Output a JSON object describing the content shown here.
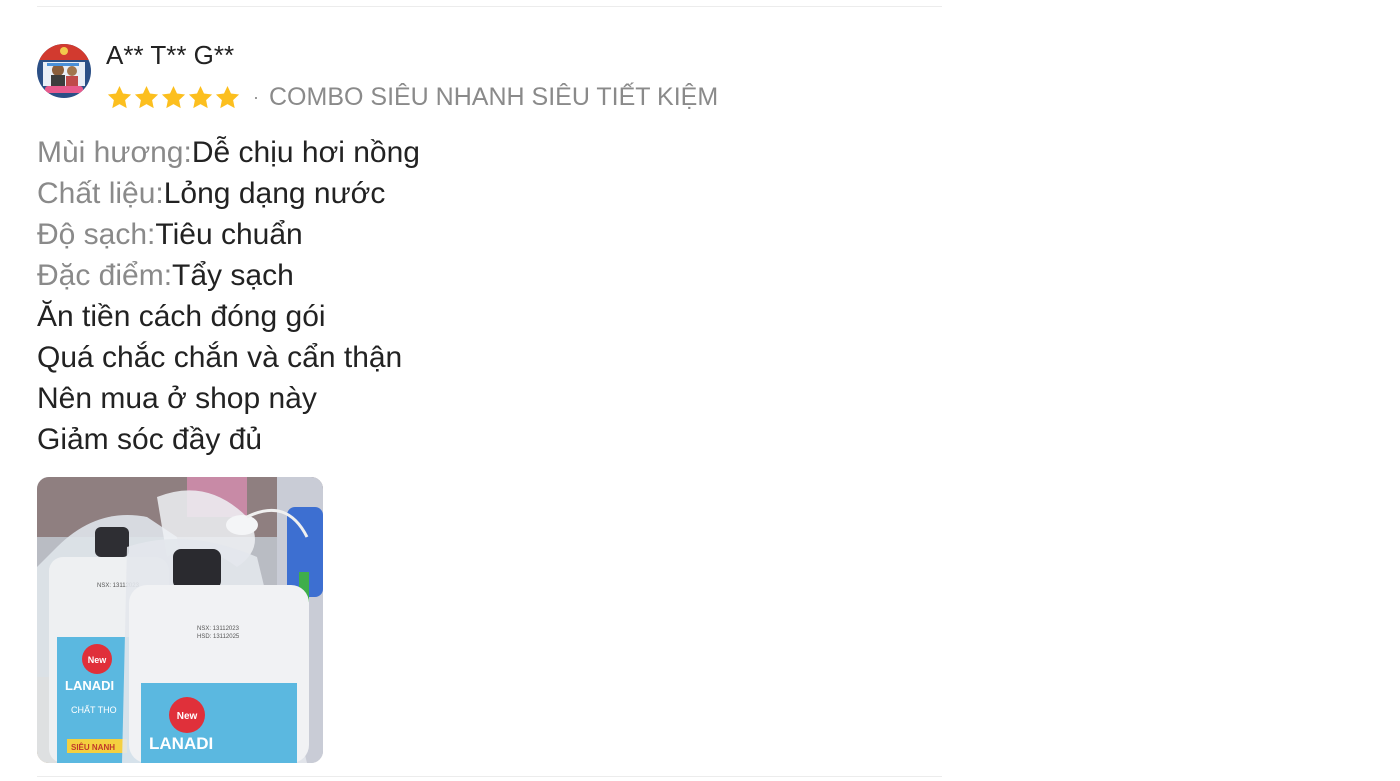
{
  "review": {
    "username": "A** T** G**",
    "rating": 5,
    "star_color": "#fcbf1e",
    "variation": "COMBO SIÊU NHANH SIÊU TIẾT KIỆM",
    "separator": "·",
    "attributes": [
      {
        "label": "Mùi hương:",
        "value": "Dễ chịu hơi nồng"
      },
      {
        "label": "Chất liệu:",
        "value": "Lỏng dạng nước"
      },
      {
        "label": "Độ sạch:",
        "value": "Tiêu chuẩn"
      },
      {
        "label": "Đặc điểm:",
        "value": "Tẩy sạch"
      }
    ],
    "comment_lines": [
      "Ăn tiền cách đóng gói",
      "Quá chắc chắn và cẩn thận",
      "Nên mua ở shop này",
      "Giảm sóc đầy đủ"
    ],
    "photo": {
      "brand_text": "LANADI",
      "badge_text": "New",
      "subtitle_text": "CHẤT THO",
      "bottom_tag_text": "SIÊU NANH",
      "date_text_1": "NSX: 13112023",
      "date_text_2": "HSD: 13112025"
    }
  }
}
